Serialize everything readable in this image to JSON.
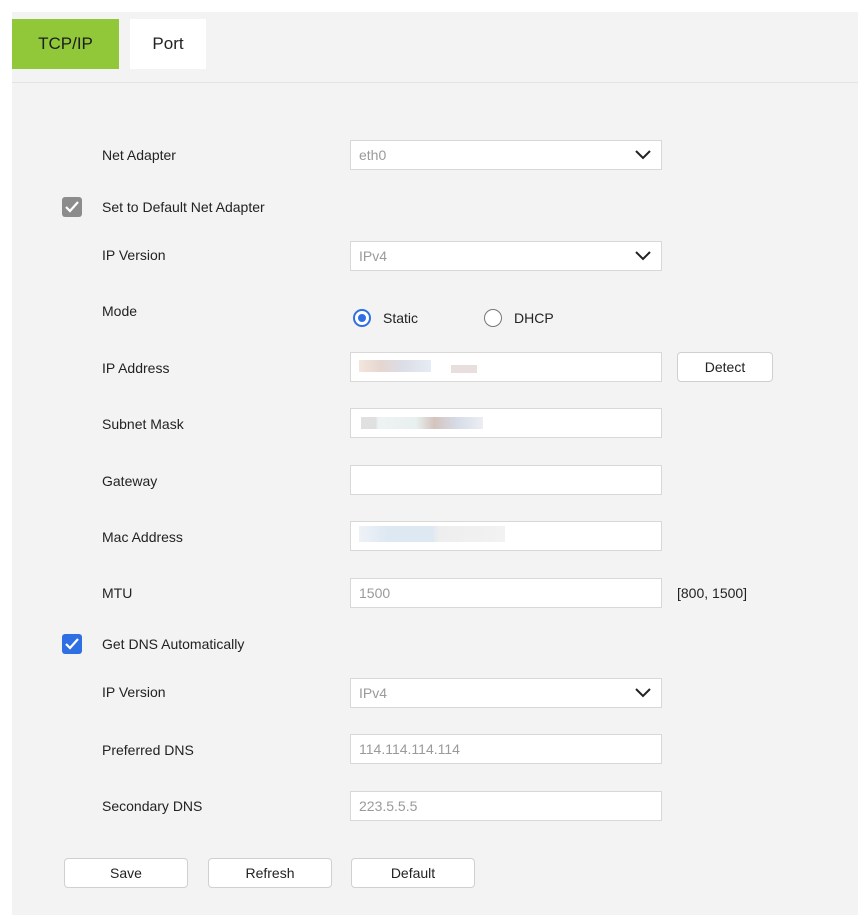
{
  "tabs": {
    "tcpip": "TCP/IP",
    "port": "Port"
  },
  "form": {
    "net_adapter": {
      "label": "Net Adapter",
      "value": "eth0"
    },
    "default_adapter": {
      "label": "Set to Default Net Adapter",
      "checked": true
    },
    "ip_version": {
      "label": "IP Version",
      "value": "IPv4"
    },
    "mode": {
      "label": "Mode",
      "options": [
        "Static",
        "DHCP"
      ],
      "selected": "Static"
    },
    "ip_address": {
      "label": "IP Address",
      "value": ""
    },
    "detect_button": "Detect",
    "subnet_mask": {
      "label": "Subnet Mask",
      "value": ""
    },
    "gateway": {
      "label": "Gateway",
      "value": ""
    },
    "mac_address": {
      "label": "Mac Address",
      "value": ""
    },
    "mtu": {
      "label": "MTU",
      "value": "1500",
      "range": "[800, 1500]"
    },
    "get_dns": {
      "label": "Get DNS Automatically",
      "checked": true
    },
    "dns_ip_version": {
      "label": "IP Version",
      "value": "IPv4"
    },
    "preferred_dns": {
      "label": "Preferred DNS",
      "value": "114.114.114.114"
    },
    "secondary_dns": {
      "label": "Secondary DNS",
      "value": "223.5.5.5"
    }
  },
  "buttons": {
    "save": "Save",
    "refresh": "Refresh",
    "default": "Default"
  },
  "colors": {
    "tab_active": "#90c83a",
    "accent_blue": "#2f6fe4",
    "checkbox_gray": "#8c8c8c"
  }
}
